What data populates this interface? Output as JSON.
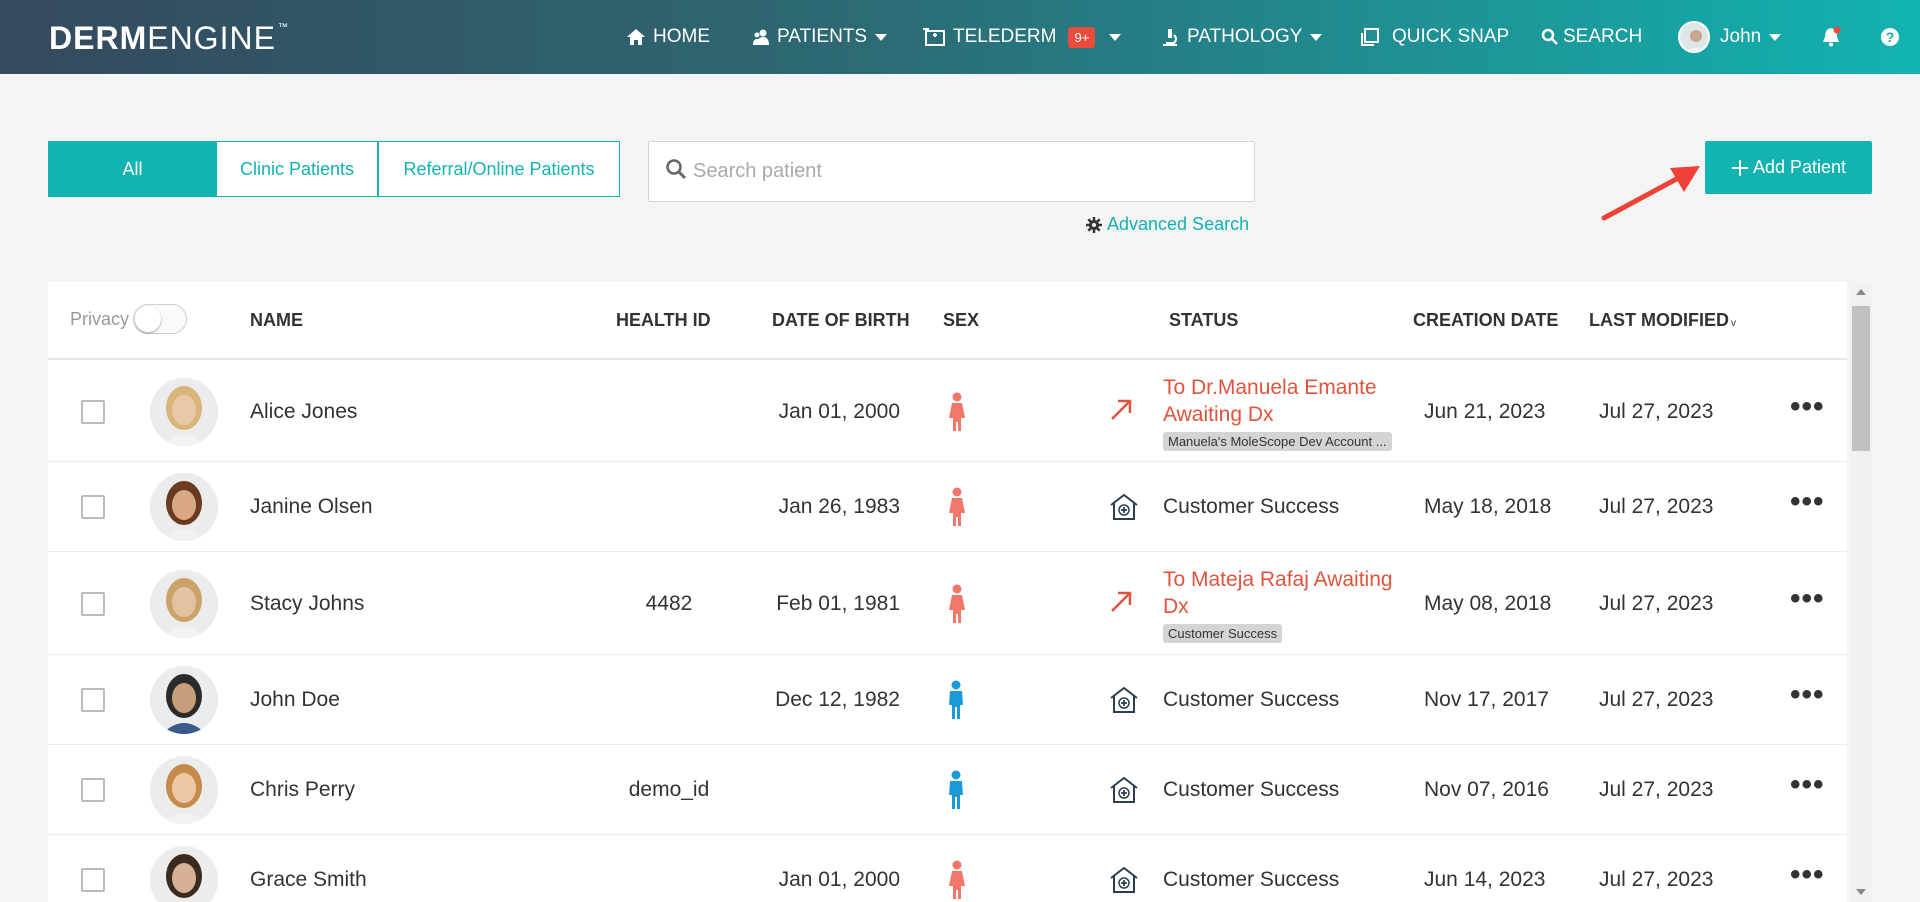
{
  "app": {
    "logo_bold": "DERM",
    "logo_light": "ENGINE",
    "logo_tm": "™"
  },
  "nav": {
    "home": "HOME",
    "patients": "PATIENTS",
    "telederm": "TELEDERM",
    "telederm_badge": "9+",
    "pathology": "PATHOLOGY",
    "quick_snap": "QUICK SNAP",
    "search": "SEARCH",
    "user": "John"
  },
  "filters": {
    "all": "All",
    "clinic": "Clinic Patients",
    "referral": "Referral/Online Patients"
  },
  "search": {
    "placeholder": "Search patient"
  },
  "advanced_search": "Advanced Search",
  "add_patient": "Add Patient",
  "table": {
    "privacy": "Privacy",
    "headers": {
      "name": "NAME",
      "health_id": "HEALTH ID",
      "dob": "DATE OF BIRTH",
      "sex": "SEX",
      "status": "STATUS",
      "creation": "CREATION DATE",
      "modified": "LAST MODIFIED"
    },
    "rows": [
      {
        "name": "Alice Jones",
        "health_id": "",
        "dob": "Jan 01, 2000",
        "sex": "female",
        "status_type": "referral",
        "status": "To Dr.Manuela Emante Awaiting Dx",
        "tag": "Manuela's MoleScope Dev Account ...",
        "created": "Jun 21, 2023",
        "modified": "Jul 27, 2023"
      },
      {
        "name": "Janine Olsen",
        "health_id": "",
        "dob": "Jan 26, 1983",
        "sex": "female",
        "status_type": "clinic",
        "status": "Customer Success",
        "tag": "",
        "created": "May 18, 2018",
        "modified": "Jul 27, 2023"
      },
      {
        "name": "Stacy Johns",
        "health_id": "4482",
        "dob": "Feb 01, 1981",
        "sex": "female",
        "status_type": "referral",
        "status": "To Mateja Rafaj Awaiting Dx",
        "tag": "Customer Success",
        "created": "May 08, 2018",
        "modified": "Jul 27, 2023"
      },
      {
        "name": "John Doe",
        "health_id": "",
        "dob": "Dec 12, 1982",
        "sex": "male",
        "status_type": "clinic",
        "status": "Customer Success",
        "tag": "",
        "created": "Nov 17, 2017",
        "modified": "Jul 27, 2023"
      },
      {
        "name": "Chris Perry",
        "health_id": "demo_id",
        "dob": "",
        "sex": "male",
        "status_type": "clinic",
        "status": "Customer Success",
        "tag": "",
        "created": "Nov 07, 2016",
        "modified": "Jul 27, 2023"
      },
      {
        "name": "Grace Smith",
        "health_id": "",
        "dob": "Jan 01, 2000",
        "sex": "female",
        "status_type": "clinic",
        "status": "Customer Success",
        "tag": "",
        "created": "Jun 14, 2023",
        "modified": "Jul 27, 2023"
      }
    ]
  },
  "colors": {
    "accent": "#12b3b1",
    "female": "#f0776a",
    "male": "#1a9bd6",
    "referral": "#e1533d"
  }
}
